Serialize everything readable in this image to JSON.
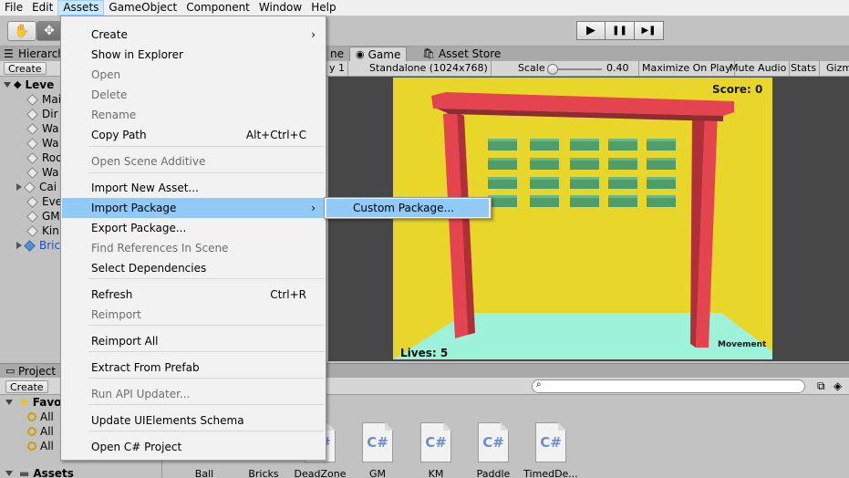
{
  "menubar": {
    "items": [
      {
        "label": "File"
      },
      {
        "label": "Edit"
      },
      {
        "label": "Assets"
      },
      {
        "label": "GameObject"
      },
      {
        "label": "Component"
      },
      {
        "label": "Window"
      },
      {
        "label": "Help"
      }
    ]
  },
  "toolbar": {
    "tools": [
      "hand-tool-icon",
      "move-tool-icon"
    ],
    "play_glyph": "▶",
    "pause_glyph": "❚❚",
    "step_glyph": "▶❚"
  },
  "hierarchy": {
    "tab": "Hierarch",
    "create": "Create",
    "scene_name": "Leve",
    "items": [
      {
        "label": "Mai",
        "expandable": false,
        "color": "#000000"
      },
      {
        "label": "Dir",
        "expandable": false,
        "color": "#000000"
      },
      {
        "label": "Wa",
        "expandable": false,
        "color": "#000000"
      },
      {
        "label": "Wa",
        "expandable": false,
        "color": "#000000"
      },
      {
        "label": "Roo",
        "expandable": false,
        "color": "#000000"
      },
      {
        "label": "Wa",
        "expandable": false,
        "color": "#000000"
      },
      {
        "label": "Cai",
        "expandable": true,
        "color": "#000000"
      },
      {
        "label": "Eve",
        "expandable": false,
        "color": "#000000"
      },
      {
        "label": "GM",
        "expandable": false,
        "color": "#000000"
      },
      {
        "label": "Kin",
        "expandable": false,
        "color": "#000000"
      },
      {
        "label": "Bric",
        "expandable": true,
        "color": "#1f4fbf"
      }
    ]
  },
  "game_tabs": {
    "scene_fragment": "ne",
    "game": "Game",
    "asset_store": "Asset Store"
  },
  "game_toolbar": {
    "display_fragment": "y 1",
    "resolution": "Standalone (1024x768)",
    "scale_label": "Scale",
    "scale_value": "0.40",
    "maximize": "Maximize On Play",
    "mute": "Mute Audio",
    "stats": "Stats",
    "gizmos": "Gizm"
  },
  "game_hud": {
    "score": "Score: 0",
    "lives": "Lives: 5",
    "movement": "Movement"
  },
  "colors": {
    "background_wall": "#e9d62a",
    "floor": "#9ff2da",
    "frame": "#e4444f",
    "bricks": "#4f9d6a",
    "menu_highlight": "#91c9f7"
  },
  "project": {
    "tab": "Project",
    "create": "Create",
    "favorites": "Favo",
    "fav_items": [
      "All",
      "All",
      "All"
    ],
    "assets_root": "Assets",
    "files": [
      {
        "label": "Ball",
        "type": "material"
      },
      {
        "label": "Bricks",
        "type": "prefab"
      },
      {
        "label": "DeadZone",
        "type": "cs"
      },
      {
        "label": "GM",
        "type": "cs"
      },
      {
        "label": "KM",
        "type": "cs"
      },
      {
        "label": "Paddle",
        "type": "cs"
      },
      {
        "label": "TimedDe...",
        "type": "cs"
      }
    ],
    "cs_glyph": "C#"
  },
  "assets_menu": {
    "items": [
      {
        "label": "Create",
        "shortcut": "",
        "disabled": false,
        "submenu": true
      },
      {
        "label": "Show in Explorer",
        "shortcut": "",
        "disabled": false,
        "submenu": false
      },
      {
        "label": "Open",
        "shortcut": "",
        "disabled": true,
        "submenu": false
      },
      {
        "label": "Delete",
        "shortcut": "",
        "disabled": true,
        "submenu": false
      },
      {
        "label": "Rename",
        "shortcut": "",
        "disabled": true,
        "submenu": false
      },
      {
        "label": "Copy Path",
        "shortcut": "Alt+Ctrl+C",
        "disabled": false,
        "submenu": false
      },
      {
        "label": "Open Scene Additive",
        "shortcut": "",
        "disabled": true,
        "submenu": false
      },
      {
        "label": "Import New Asset...",
        "shortcut": "",
        "disabled": false,
        "submenu": false
      },
      {
        "label": "Import Package",
        "shortcut": "",
        "disabled": false,
        "submenu": true,
        "highlighted": true
      },
      {
        "label": "Export Package...",
        "shortcut": "",
        "disabled": false,
        "submenu": false
      },
      {
        "label": "Find References In Scene",
        "shortcut": "",
        "disabled": true,
        "submenu": false
      },
      {
        "label": "Select Dependencies",
        "shortcut": "",
        "disabled": false,
        "submenu": false
      },
      {
        "label": "Refresh",
        "shortcut": "Ctrl+R",
        "disabled": false,
        "submenu": false
      },
      {
        "label": "Reimport",
        "shortcut": "",
        "disabled": true,
        "submenu": false
      },
      {
        "label": "Reimport All",
        "shortcut": "",
        "disabled": false,
        "submenu": false
      },
      {
        "label": "Extract From Prefab",
        "shortcut": "",
        "disabled": false,
        "submenu": false
      },
      {
        "label": "Run API Updater...",
        "shortcut": "",
        "disabled": true,
        "submenu": false
      },
      {
        "label": "Update UIElements Schema",
        "shortcut": "",
        "disabled": false,
        "submenu": false
      },
      {
        "label": "Open C# Project",
        "shortcut": "",
        "disabled": false,
        "submenu": false
      }
    ],
    "submenu_arrow": "›"
  },
  "import_package_submenu": {
    "items": [
      {
        "label": "Custom Package..."
      }
    ]
  }
}
